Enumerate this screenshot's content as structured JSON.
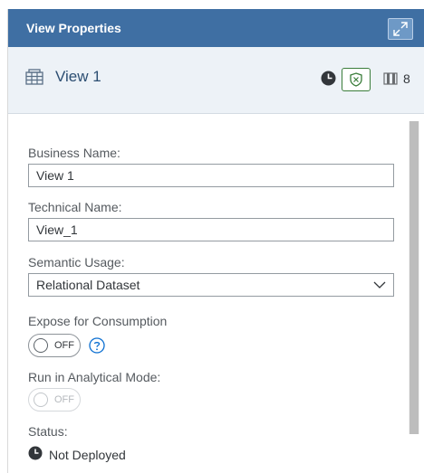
{
  "panel": {
    "title": "View Properties",
    "expand_icon": "expand-icon"
  },
  "object": {
    "name": "View 1",
    "icon": "view-table-icon",
    "columns_count": "8"
  },
  "form": {
    "business_name_label": "Business Name:",
    "business_name_value": "View 1",
    "technical_name_label": "Technical Name:",
    "technical_name_value": "View_1",
    "semantic_usage_label": "Semantic Usage:",
    "semantic_usage_value": "Relational Dataset",
    "expose_label": "Expose for Consumption",
    "expose_state": "OFF",
    "analytical_label": "Run in Analytical Mode:",
    "analytical_state": "OFF",
    "status_label": "Status:",
    "status_value": "Not Deployed"
  },
  "colors": {
    "header": "#3f6fa3",
    "object_header": "#edf2f7",
    "title_text": "#2c4e72",
    "shield_green": "#3a7d3a"
  }
}
